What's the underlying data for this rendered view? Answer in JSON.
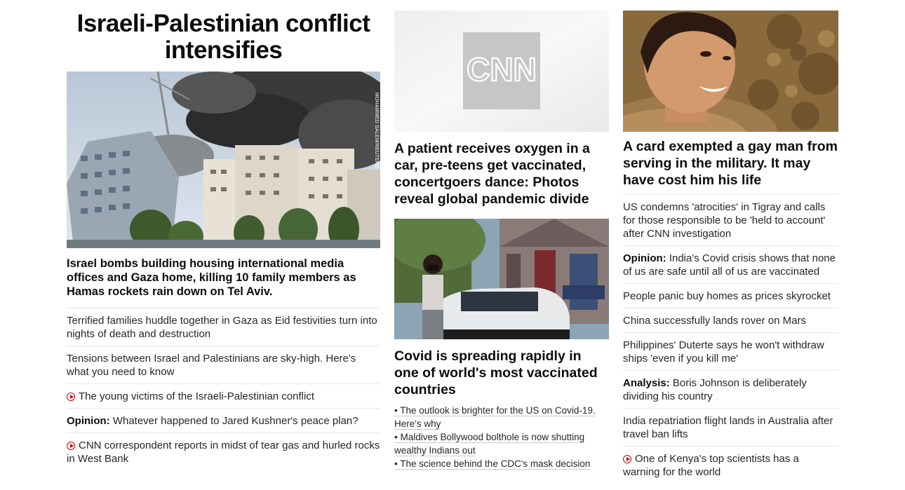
{
  "col1": {
    "section_title": "Israeli-Palestinian conflict intensifies",
    "photo_credit": "MOHAMMED SALEM/REUTERS",
    "lead_headline": "Israel bombs building housing international media offices and Gaza home, killing 10 family members as Hamas rockets rain down on Tel Aviv.",
    "items": [
      {
        "prefix": "",
        "text": "Terrified families huddle together in Gaza as Eid festivities turn into nights of death and destruction",
        "video": false
      },
      {
        "prefix": "",
        "text": "Tensions between Israel and Palestinians are sky-high. Here's what you need to know",
        "video": false
      },
      {
        "prefix": "",
        "text": "The young victims of the Israeli-Palestinian conflict",
        "video": true
      },
      {
        "prefix": "Opinion:",
        "text": " Whatever happened to Jared Kushner's peace plan?",
        "video": false
      },
      {
        "prefix": "",
        "text": "CNN correspondent reports in midst of tear gas and hurled rocks in West Bank",
        "video": true
      }
    ]
  },
  "col2": {
    "logo_text": "CNN",
    "card1_headline": "A patient receives oxygen in a car, pre-teens get vaccinated, concertgoers dance: Photos reveal global pandemic divide",
    "card2_headline": "Covid is spreading rapidly in one of world's most vaccinated countries",
    "bullets": [
      "• The outlook is brighter for the US on Covid-19. Here's why",
      "• Maldives Bollywood bolthole is now shutting wealthy Indians out",
      "• The science behind the CDC's mask decision"
    ]
  },
  "col3": {
    "card_headline": "A card exempted a gay man from serving in the military. It may have cost him his life",
    "items": [
      {
        "prefix": "",
        "text": "US condemns 'atrocities' in Tigray and calls for those responsible to be 'held to account' after CNN investigation",
        "video": false
      },
      {
        "prefix": "Opinion:",
        "text": " India's Covid crisis shows that none of us are safe until all of us are vaccinated",
        "video": false
      },
      {
        "prefix": "",
        "text": "People panic buy homes as prices skyrocket",
        "video": false
      },
      {
        "prefix": "",
        "text": "China successfully lands rover on Mars",
        "video": false
      },
      {
        "prefix": "",
        "text": "Philippines' Duterte says he won't withdraw ships 'even if you kill me'",
        "video": false
      },
      {
        "prefix": "Analysis:",
        "text": " Boris Johnson is deliberately dividing his country",
        "video": false
      },
      {
        "prefix": "",
        "text": "India repatriation flight lands in Australia after travel ban lifts",
        "video": false
      },
      {
        "prefix": "",
        "text": "One of Kenya's top scientists has a warning for the world",
        "video": true
      }
    ]
  },
  "colors": {
    "video_icon": "#cc0000",
    "divider": "#e6e6e6",
    "headline": "#0c0c0c"
  }
}
